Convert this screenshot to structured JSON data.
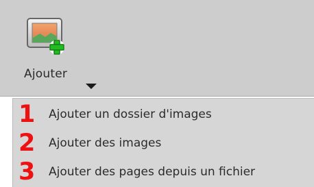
{
  "toolbar": {
    "add_button": {
      "label": "Ajouter",
      "icon": "add-image-icon",
      "arrow_icon": "dropdown-arrow-icon"
    }
  },
  "menu": {
    "items": [
      {
        "number": "1",
        "label": "Ajouter un dossier d'images"
      },
      {
        "number": "2",
        "label": "Ajouter des images"
      },
      {
        "number": "3",
        "label": "Ajouter des pages depuis un fichier"
      }
    ]
  },
  "colors": {
    "toolbar_bg": "#cdcdcd",
    "menu_bg": "#d6d6d6",
    "annotation_red": "#ee1111",
    "plus_green": "#22bb22"
  }
}
